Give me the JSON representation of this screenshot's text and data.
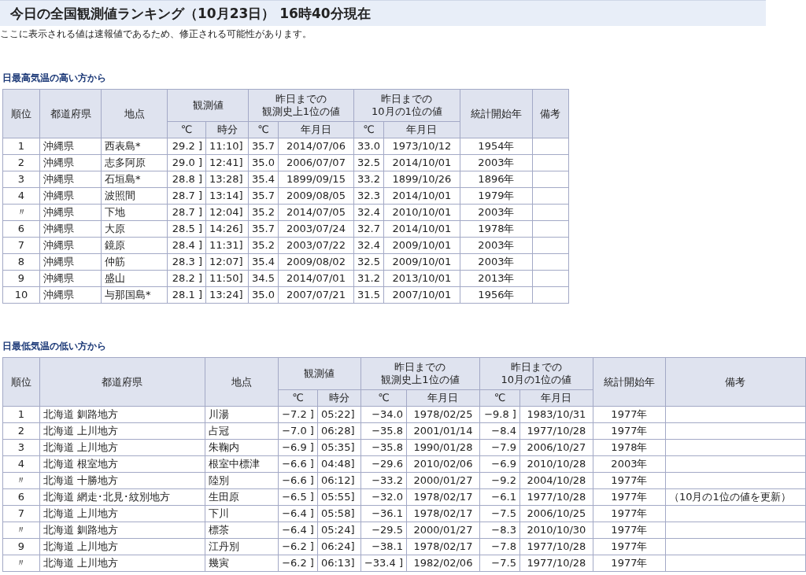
{
  "title": "今日の全国観測値ランキング（10月23日） 16時40分現在",
  "note": "ここに表示される値は速報値であるため、修正される可能性があります。",
  "sections": [
    {
      "heading": "日最高気温の高い方から",
      "header_rows": [
        [
          {
            "label": "順位",
            "rowspan": 2
          },
          {
            "label": "都道府県",
            "rowspan": 2
          },
          {
            "label": "地点",
            "rowspan": 2
          },
          {
            "label": "観測値",
            "colspan": 2
          },
          {
            "label_lines": [
              "昨日までの",
              "観測史上1位の値"
            ],
            "colspan": 2
          },
          {
            "label_lines": [
              "昨日までの",
              "10月の1位の値"
            ],
            "colspan": 2
          },
          {
            "label": "統計開始年",
            "rowspan": 2
          },
          {
            "label": "備考",
            "rowspan": 2
          }
        ],
        [
          {
            "label": "℃"
          },
          {
            "label": "時分"
          },
          {
            "label": "℃"
          },
          {
            "label": "年月日"
          },
          {
            "label": "℃"
          },
          {
            "label": "年月日"
          }
        ]
      ],
      "rows": [
        {
          "cells": [
            "1",
            "沖縄県",
            "西表島*",
            "29.2 ]",
            "11:10]",
            "35.7",
            "2014/07/06",
            "33.0",
            "1973/10/12",
            "1954年"
          ]
        },
        {
          "cells": [
            "2",
            "沖縄県",
            "志多阿原",
            "29.0 ]",
            "12:41]",
            "35.0",
            "2006/07/07",
            "32.5",
            "2014/10/01",
            "2003年"
          ]
        },
        {
          "cells": [
            "3",
            "沖縄県",
            "石垣島*",
            "28.8 ]",
            "13:28]",
            "35.4",
            "1899/09/15",
            "33.2",
            "1899/10/26",
            "1896年"
          ]
        },
        {
          "cells": [
            "4",
            "沖縄県",
            "波照間",
            "28.7 ]",
            "13:14]",
            "35.7",
            "2009/08/05",
            "32.3",
            "2014/10/01",
            "1979年"
          ]
        },
        {
          "cells": [
            "〃",
            "沖縄県",
            "下地",
            "28.7 ]",
            "12:04]",
            "35.2",
            "2014/07/05",
            "32.4",
            "2010/10/01",
            "2003年"
          ]
        },
        {
          "cells": [
            "6",
            "沖縄県",
            "大原",
            "28.5 ]",
            "14:26]",
            "35.7",
            "2003/07/24",
            "32.7",
            "2014/10/01",
            "1978年"
          ]
        },
        {
          "cells": [
            "7",
            "沖縄県",
            "鏡原",
            "28.4 ]",
            "11:31]",
            "35.2",
            "2003/07/22",
            "32.4",
            "2009/10/01",
            "2003年"
          ]
        },
        {
          "cells": [
            "8",
            "沖縄県",
            "仲筋",
            "28.3 ]",
            "12:07]",
            "35.4",
            "2009/08/02",
            "32.5",
            "2009/10/01",
            "2003年"
          ]
        },
        {
          "cells": [
            "9",
            "沖縄県",
            "盛山",
            "28.2 ]",
            "11:50]",
            "34.5",
            "2014/07/01",
            "31.2",
            "2013/10/01",
            "2013年"
          ]
        },
        {
          "cells": [
            "10",
            "沖縄県",
            "与那国島*",
            "28.1 ]",
            "13:24]",
            "35.0",
            "2007/07/21",
            "31.5",
            "2007/10/01",
            "1956年"
          ]
        }
      ]
    },
    {
      "heading": "日最低気温の低い方から",
      "header_rows": [
        [
          {
            "label": "順位",
            "rowspan": 2
          },
          {
            "label": "都道府県",
            "rowspan": 2
          },
          {
            "label": "地点",
            "rowspan": 2
          },
          {
            "label": "観測値",
            "colspan": 2
          },
          {
            "label_lines": [
              "昨日までの",
              "観測史上1位の値"
            ],
            "colspan": 2
          },
          {
            "label_lines": [
              "昨日までの",
              "10月の1位の値"
            ],
            "colspan": 2
          },
          {
            "label": "統計開始年",
            "rowspan": 2
          },
          {
            "label": "備考",
            "rowspan": 2
          }
        ],
        [
          {
            "label": "℃"
          },
          {
            "label": "時分"
          },
          {
            "label": "℃"
          },
          {
            "label": "年月日"
          },
          {
            "label": "℃"
          },
          {
            "label": "年月日"
          }
        ]
      ],
      "rows": [
        {
          "cells": [
            "1",
            "北海道 釧路地方",
            "川湯",
            "−7.2 ]",
            "05:22]",
            "−34.0",
            "1978/02/25",
            "−9.8 ]",
            "1983/10/31",
            "1977年"
          ]
        },
        {
          "cells": [
            "2",
            "北海道 上川地方",
            "占冠",
            "−7.0 ]",
            "06:28]",
            "−35.8",
            "2001/01/14",
            "−8.4",
            "1977/10/28",
            "1977年"
          ]
        },
        {
          "cells": [
            "3",
            "北海道 上川地方",
            "朱鞠内",
            "−6.9 ]",
            "05:35]",
            "−35.8",
            "1990/01/28",
            "−7.9",
            "2006/10/27",
            "1978年"
          ]
        },
        {
          "cells": [
            "4",
            "北海道 根室地方",
            "根室中標津",
            "−6.6 ]",
            "04:48]",
            "−29.6",
            "2010/02/06",
            "−6.9",
            "2010/10/28",
            "2003年"
          ]
        },
        {
          "cells": [
            "〃",
            "北海道 十勝地方",
            "陸別",
            "−6.6 ]",
            "06:12]",
            "−33.2",
            "2000/01/27",
            "−9.2",
            "2004/10/28",
            "1977年"
          ]
        },
        {
          "cells": [
            "6",
            "北海道 網走･北見･紋別地方",
            "生田原",
            "−6.5 ]",
            "05:55]",
            "−32.0",
            "1978/02/17",
            "−6.1",
            "1977/10/28",
            "1977年"
          ],
          "remarks": "（10月の1位の値を更新）"
        },
        {
          "cells": [
            "7",
            "北海道 上川地方",
            "下川",
            "−6.4 ]",
            "05:58]",
            "−36.1",
            "1978/02/17",
            "−7.5",
            "2006/10/25",
            "1977年"
          ]
        },
        {
          "cells": [
            "〃",
            "北海道 釧路地方",
            "標茶",
            "−6.4 ]",
            "05:24]",
            "−29.5",
            "2000/01/27",
            "−8.3",
            "2010/10/30",
            "1977年"
          ]
        },
        {
          "cells": [
            "9",
            "北海道 上川地方",
            "江丹別",
            "−6.2 ]",
            "06:24]",
            "−38.1",
            "1978/02/17",
            "−7.8",
            "1977/10/28",
            "1977年"
          ]
        },
        {
          "cells": [
            "〃",
            "北海道 上川地方",
            "幾寅",
            "−6.2 ]",
            "06:13]",
            "−33.4 ]",
            "1982/02/06",
            "−7.5",
            "1977/10/28",
            "1977年"
          ]
        }
      ]
    }
  ]
}
